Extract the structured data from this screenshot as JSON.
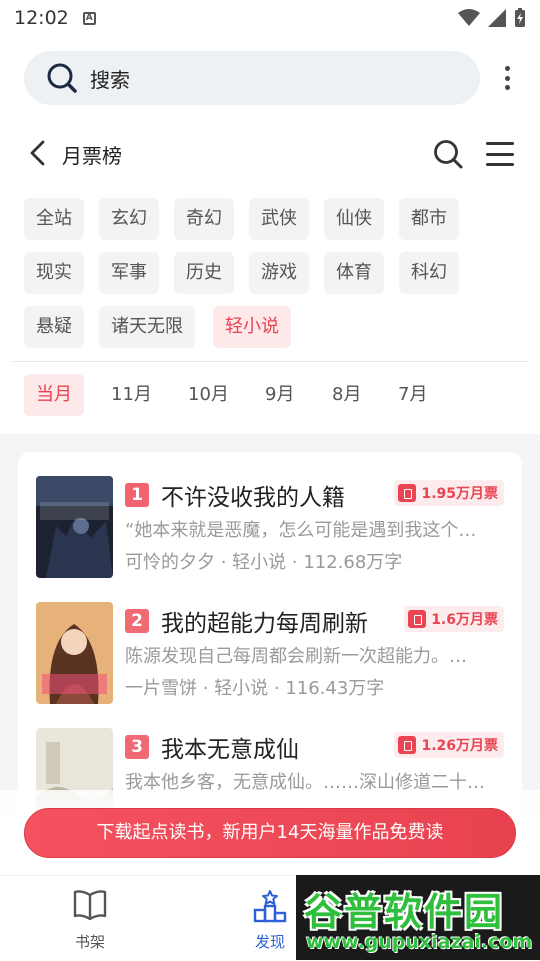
{
  "status": {
    "time": "12:02"
  },
  "search": {
    "label": "搜索"
  },
  "header": {
    "title": "月票榜"
  },
  "categories": [
    "全站",
    "玄幻",
    "奇幻",
    "武侠",
    "仙侠",
    "都市",
    "现实",
    "军事",
    "历史",
    "游戏",
    "体育",
    "科幻",
    "悬疑",
    "诸天无限",
    "轻小说"
  ],
  "active_category": "轻小说",
  "months": [
    "当月",
    "11月",
    "10月",
    "9月",
    "8月",
    "7月"
  ],
  "active_month": "当月",
  "books": [
    {
      "rank": "1",
      "title": "不许没收我的人籍",
      "votes": "1.95万月票",
      "desc": "“她本来就是恶魔，怎么可能是遇到我这个…",
      "meta": "可怜的夕夕 · 轻小说 · 112.68万字"
    },
    {
      "rank": "2",
      "title": "我的超能力每周刷新",
      "votes": "1.6万月票",
      "desc": "陈源发现自己每周都会刷新一次超能力。…",
      "meta": "一片雪饼 · 轻小说 · 116.43万字"
    },
    {
      "rank": "3",
      "title": "我本无意成仙",
      "votes": "1.26万月票",
      "desc": "我本他乡客，无意成仙。……深山修道二十…",
      "meta": ""
    }
  ],
  "banner": {
    "text": "下载起点读书，新用户14天海量作品免费读"
  },
  "tabs": [
    {
      "label": "书架",
      "icon": "book-open-icon"
    },
    {
      "label": "发现",
      "icon": "discover-icon"
    }
  ],
  "watermark": {
    "logo": "谷普软件园",
    "url": "www.gupuxiazai.com"
  },
  "colors": {
    "accent": "#e94452",
    "active_tab": "#2d5fd6"
  }
}
